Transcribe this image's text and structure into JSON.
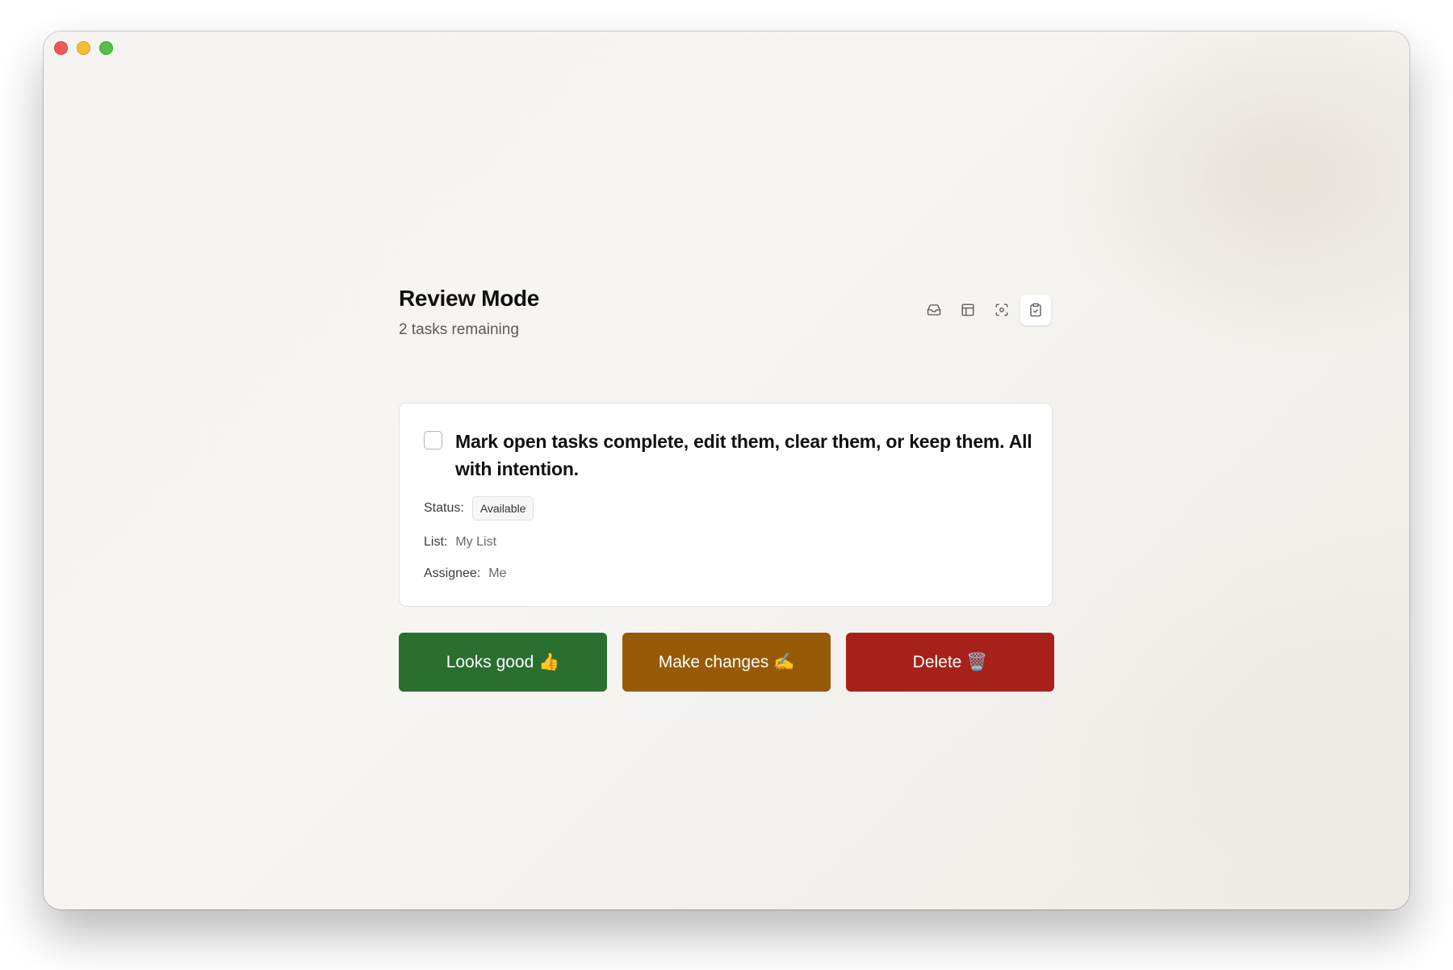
{
  "window": {
    "controls": [
      "close",
      "minimize",
      "maximize"
    ]
  },
  "header": {
    "title": "Review Mode",
    "subtitle": "2 tasks remaining"
  },
  "toolbar": {
    "buttons": [
      {
        "icon": "inbox-icon",
        "active": false
      },
      {
        "icon": "layout-icon",
        "active": false
      },
      {
        "icon": "focus-icon",
        "active": false
      },
      {
        "icon": "clipboard-check-icon",
        "active": true
      }
    ]
  },
  "task": {
    "title": "Mark open tasks complete, edit them, clear them, or keep them. All with intention.",
    "checked": false,
    "status_label": "Status:",
    "status_value": "Available",
    "list_label": "List:",
    "list_value": "My List",
    "assignee_label": "Assignee:",
    "assignee_value": "Me"
  },
  "actions": {
    "looks_good": "Looks good 👍",
    "make_changes": "Make changes ✍️",
    "delete": "Delete 🗑️"
  },
  "colors": {
    "looks_good": "#2a6e30",
    "make_changes": "#975a06",
    "delete": "#a8201a"
  }
}
